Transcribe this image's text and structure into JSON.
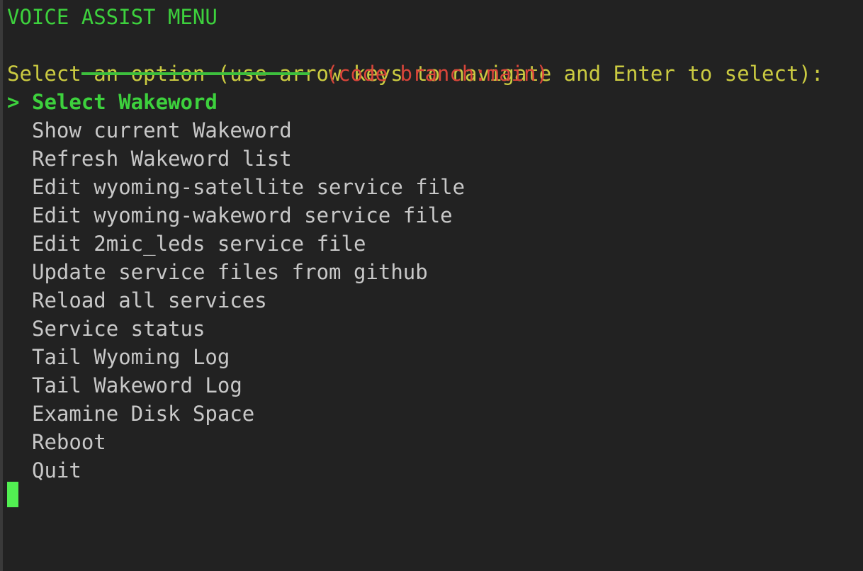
{
  "terminal": {
    "background_color": "#222222",
    "title": "VOICE ASSIST MENU",
    "title_color": "#3dd13d",
    "rule_color": "#3dbf3d",
    "branch_label": "(code branch:main)",
    "branch_color": "#d8453a",
    "prompt": "Select an option (use arrow keys to navigate and Enter to select):",
    "prompt_color": "#cbcb41",
    "item_color": "#c8c8c8",
    "selected_color": "#3dd13d",
    "cursor_color": "#52f052"
  },
  "menu": {
    "selected_index": 0,
    "selected_marker": ">",
    "unselected_marker": " ",
    "items": [
      {
        "label": "Select Wakeword",
        "selected": true
      },
      {
        "label": "Show current Wakeword",
        "selected": false
      },
      {
        "label": "Refresh Wakeword list",
        "selected": false
      },
      {
        "label": "Edit wyoming-satellite service file",
        "selected": false
      },
      {
        "label": "Edit wyoming-wakeword service file",
        "selected": false
      },
      {
        "label": "Edit 2mic_leds service file",
        "selected": false
      },
      {
        "label": "Update service files from github",
        "selected": false
      },
      {
        "label": "Reload all services",
        "selected": false
      },
      {
        "label": "Service status",
        "selected": false
      },
      {
        "label": "Tail Wyoming Log",
        "selected": false
      },
      {
        "label": "Tail Wakeword Log",
        "selected": false
      },
      {
        "label": "Examine Disk Space",
        "selected": false
      },
      {
        "label": "Reboot",
        "selected": false
      },
      {
        "label": "Quit",
        "selected": false
      }
    ]
  }
}
